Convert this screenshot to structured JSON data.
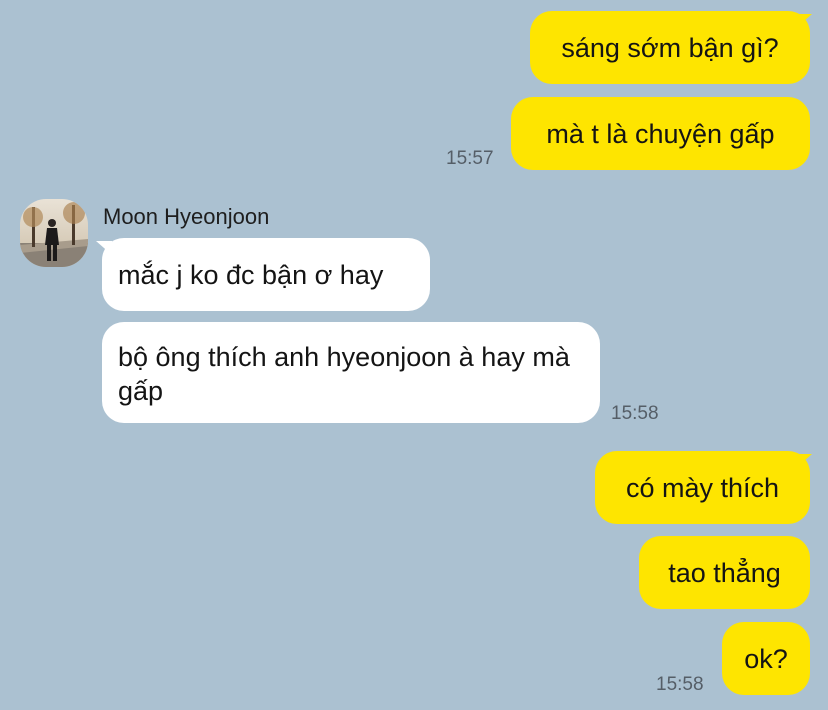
{
  "messages": {
    "m1": "sáng sớm bận gì?",
    "m2": "mà t là chuyện gấp",
    "time1": "15:57",
    "sender_name": "Moon Hyeonjoon",
    "m3": "mắc j ko đc bận ơ hay",
    "m4": "bộ ông thích anh hyeonjoon à hay mà gấp",
    "time2": "15:58",
    "m5": "có mày thích",
    "m6": "tao thẳng",
    "m7": "ok?",
    "time3": "15:58"
  },
  "colors": {
    "background": "#abc1d1",
    "my_bubble": "#fee500",
    "their_bubble": "#ffffff"
  }
}
